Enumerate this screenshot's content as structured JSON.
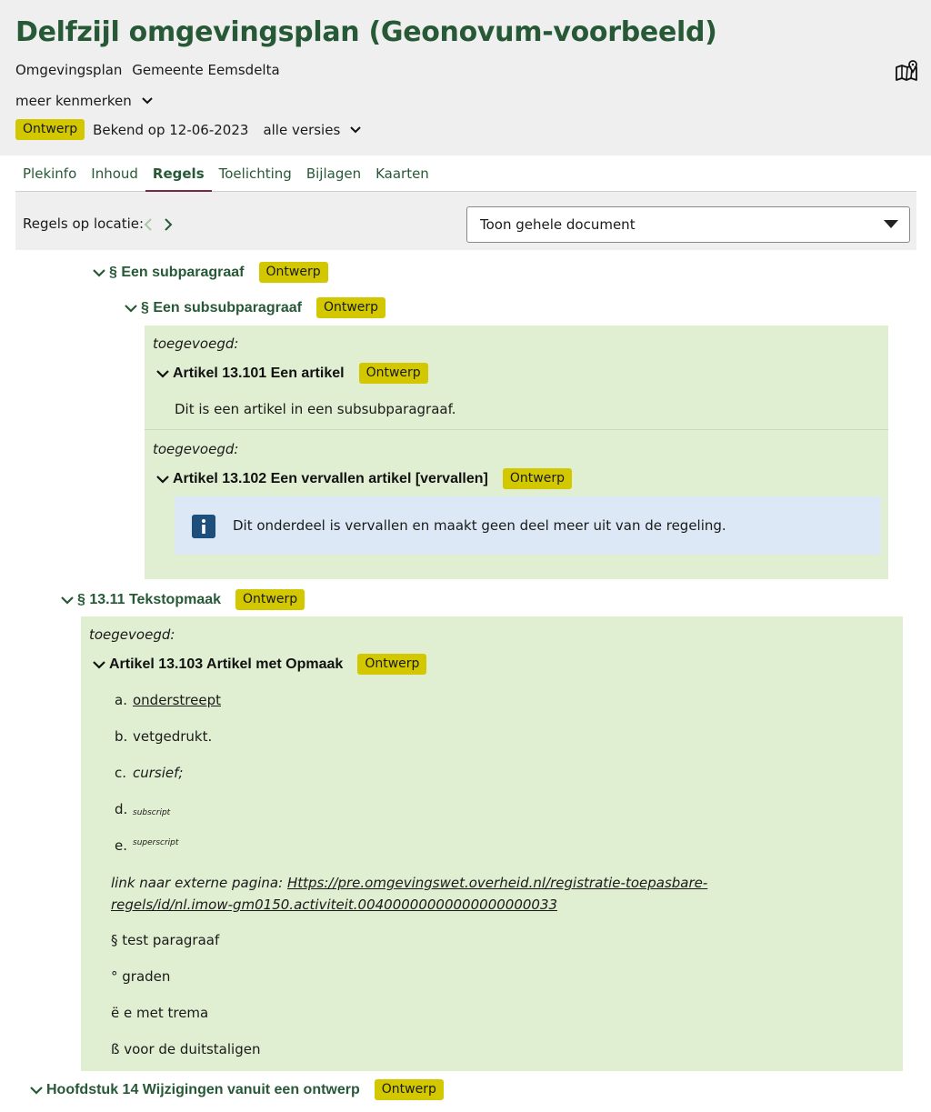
{
  "header": {
    "title": "Delfzijl omgevingsplan (Geonovum-voorbeeld)",
    "doc_type": "Omgevingsplan",
    "authority": "Gemeente Eemsdelta",
    "more_label": "meer kenmerken",
    "status_badge": "Ontwerp",
    "known_on": "Bekend op 12-06-2023",
    "versions_label": "alle versies",
    "map_icon": "map-pin-icon"
  },
  "tabs": [
    {
      "label": "Plekinfo",
      "active": false
    },
    {
      "label": "Inhoud",
      "active": false
    },
    {
      "label": "Regels",
      "active": true
    },
    {
      "label": "Toelichting",
      "active": false
    },
    {
      "label": "Bijlagen",
      "active": false
    },
    {
      "label": "Kaarten",
      "active": false
    }
  ],
  "location": {
    "label": "Regels op locatie:",
    "select_value": "Toon gehele document"
  },
  "content": {
    "subparagraaf": {
      "title": "§ Een subparagraaf",
      "badge": "Ontwerp"
    },
    "subsubparagraaf": {
      "title": "§ Een subsubparagraaf",
      "badge": "Ontwerp"
    },
    "art101": {
      "added": "toegevoegd:",
      "title": "Artikel 13.101 Een artikel",
      "badge": "Ontwerp",
      "text": "Dit is een artikel in een subsubparagraaf."
    },
    "art102": {
      "added": "toegevoegd:",
      "title": "Artikel 13.102 Een vervallen artikel [vervallen]",
      "badge": "Ontwerp",
      "notice": "Dit onderdeel is vervallen en maakt geen deel meer uit van de regeling."
    },
    "par1311": {
      "title": "§ 13.11 Tekstopmaak",
      "badge": "Ontwerp"
    },
    "art103": {
      "added": "toegevoegd:",
      "title": "Artikel 13.103 Artikel met Opmaak",
      "badge": "Ontwerp",
      "items": [
        {
          "marker": "a.",
          "text": "onderstreept"
        },
        {
          "marker": "b.",
          "text": "vetgedrukt."
        },
        {
          "marker": "c.",
          "text": "cursief;"
        },
        {
          "marker": "d.",
          "text": "subscript"
        },
        {
          "marker": "e.",
          "text": "superscript"
        }
      ],
      "link_prefix": "link naar externe pagina:",
      "link_text": "Https://pre.omgevingswet.overheid.nl/registratie-toepasbare-regels/id/nl.imow-gm0150.activiteit.00400000000000000000033",
      "lines": [
        "§ test paragraaf",
        "° graden",
        "ë e met trema",
        "ß voor de duitstaligen"
      ]
    },
    "hoofdstuk14": {
      "title": "Hoofdstuk 14 Wijzigingen vanuit een ontwerp",
      "badge": "Ontwerp"
    }
  }
}
